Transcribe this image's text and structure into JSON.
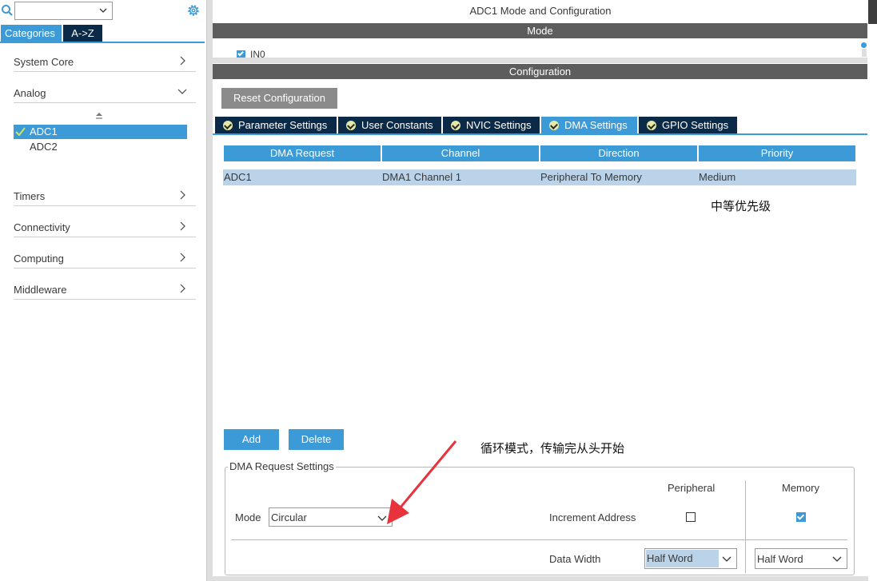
{
  "sidebar": {
    "search_value": "",
    "tabs": [
      {
        "label": "Categories",
        "active": true
      },
      {
        "label": "A->Z",
        "active": false
      }
    ],
    "categories": [
      {
        "label": "System Core",
        "expanded": false
      },
      {
        "label": "Analog",
        "expanded": true
      },
      {
        "label": "Timers",
        "expanded": false
      },
      {
        "label": "Connectivity",
        "expanded": false
      },
      {
        "label": "Computing",
        "expanded": false
      },
      {
        "label": "Middleware",
        "expanded": false
      }
    ],
    "analog_items": [
      {
        "label": "ADC1",
        "selected": true,
        "configured": true
      },
      {
        "label": "ADC2",
        "selected": false,
        "configured": false
      }
    ]
  },
  "main": {
    "title": "ADC1 Mode and Configuration",
    "mode_header": "Mode",
    "mode_channel_label": "IN0",
    "config_header": "Configuration",
    "reset_button": "Reset Configuration",
    "config_tabs": [
      {
        "label": "Parameter Settings",
        "active": false
      },
      {
        "label": "User Constants",
        "active": false
      },
      {
        "label": "NVIC Settings",
        "active": false
      },
      {
        "label": "DMA Settings",
        "active": true
      },
      {
        "label": "GPIO Settings",
        "active": false
      }
    ],
    "dma_table": {
      "headers": [
        "DMA Request",
        "Channel",
        "Direction",
        "Priority"
      ],
      "rows": [
        [
          "ADC1",
          "DMA1 Channel 1",
          "Peripheral To Memory",
          "Medium"
        ]
      ]
    },
    "annotation_priority": "中等优先级",
    "annotation_mode": "循环模式，传输完从头开始",
    "add_button": "Add",
    "delete_button": "Delete",
    "request_settings": {
      "legend": "DMA Request Settings",
      "mode_label": "Mode",
      "mode_value": "Circular",
      "col_peripheral": "Peripheral",
      "col_memory": "Memory",
      "increment_label": "Increment Address",
      "increment_peripheral": false,
      "increment_memory": true,
      "data_width_label": "Data Width",
      "data_width_peripheral": "Half Word",
      "data_width_memory": "Half Word"
    }
  },
  "colors": {
    "accent": "#3c9ad6",
    "dark_navy": "#0b2a48",
    "header_gray": "#5d5d5d",
    "row_highlight": "#bad3e8",
    "annotation_arrow": "#e8323c"
  }
}
